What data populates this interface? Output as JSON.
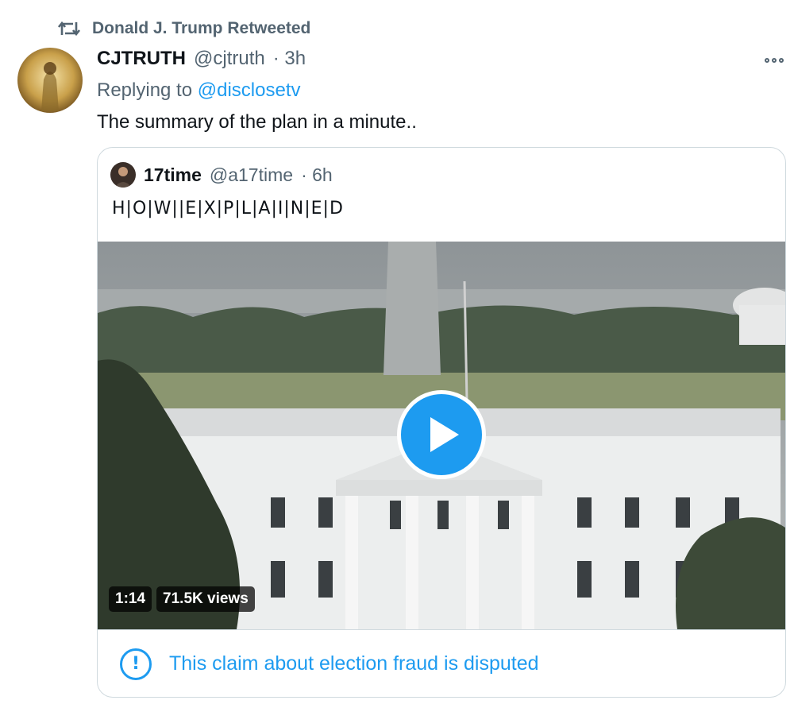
{
  "retweet": {
    "label": "Donald J. Trump Retweeted",
    "icon": "retweet-icon"
  },
  "tweet": {
    "author_name": "CJTRUTH",
    "author_handle": "@cjtruth",
    "time": "· 3h",
    "replying_prefix": "Replying to",
    "replying_to": "@disclosetv",
    "text": "The summary of the plan in a minute.."
  },
  "quote": {
    "author_name": "17time",
    "author_handle": "@a17time",
    "time": "· 6h",
    "text": "H|O|W||E|X|P|L|A|I|N|E|D"
  },
  "video": {
    "duration": "1:14",
    "views": "71.5K views"
  },
  "notice": {
    "icon": "exclamation-circle-icon",
    "text": "This claim about election fraud is disputed"
  },
  "colors": {
    "accent": "#1d9bf0",
    "secondary_text": "#536471",
    "border": "#cfd9de"
  }
}
